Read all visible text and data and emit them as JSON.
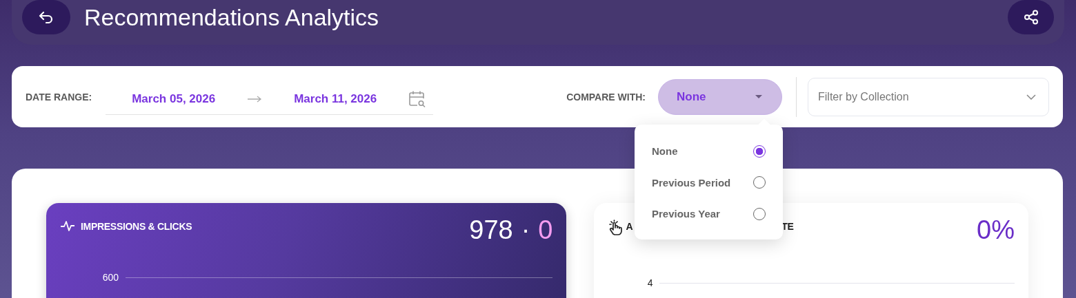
{
  "header": {
    "title": "Recommendations Analytics"
  },
  "filters": {
    "date_range_label": "DATE RANGE:",
    "start_date": "March 05, 2026",
    "end_date": "March 11, 2026",
    "compare_label": "COMPARE WITH:",
    "compare_value": "None",
    "collection_placeholder": "Filter by Collection"
  },
  "compare_menu": [
    {
      "label": "None",
      "selected": true
    },
    {
      "label": "Previous Period",
      "selected": false
    },
    {
      "label": "Previous Year",
      "selected": false
    }
  ],
  "cards": [
    {
      "kind": "dark",
      "title": "IMPRESSIONS & CLICKS",
      "value": "978",
      "separator": "·",
      "value_2": "0",
      "tick": "600"
    },
    {
      "kind": "light",
      "title": "A",
      "title_end": "TE",
      "value": "0%",
      "tick": "4"
    }
  ]
}
